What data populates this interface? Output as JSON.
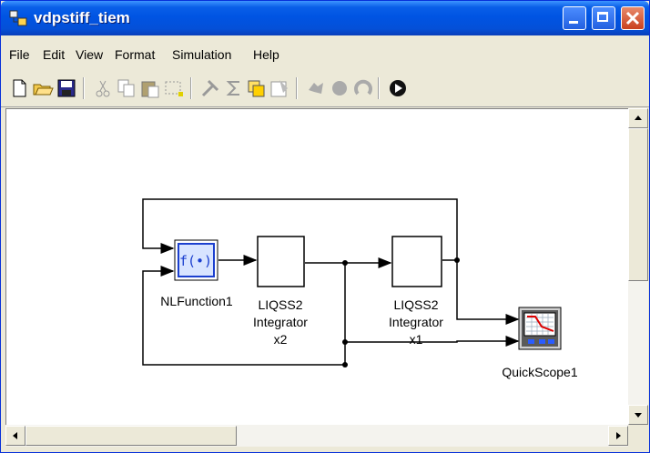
{
  "window": {
    "title": "vdpstiff_tiem"
  },
  "menu": [
    "File",
    "Edit",
    "View",
    "Format",
    "Simulation",
    "Help"
  ],
  "toolbar_icons": [
    "new-file-icon",
    "open-folder-icon",
    "save-icon",
    "cut-icon",
    "copy-icon",
    "paste-icon",
    "select-icon",
    "wrench-icon",
    "sigma-icon",
    "block-icon",
    "properties-icon",
    "rotate-icon",
    "record-icon",
    "reset-icon",
    "run-icon"
  ],
  "diagram": {
    "blocks": {
      "nlfunction": {
        "symbol": "f(•)",
        "label": "NLFunction1"
      },
      "integrator2": {
        "line1": "LIQSS2",
        "line2": "Integrator",
        "line3": "x2"
      },
      "integrator1": {
        "line1": "LIQSS2",
        "line2": "Integrator",
        "line3": "x1"
      },
      "scope": {
        "label": "QuickScope1"
      }
    }
  }
}
